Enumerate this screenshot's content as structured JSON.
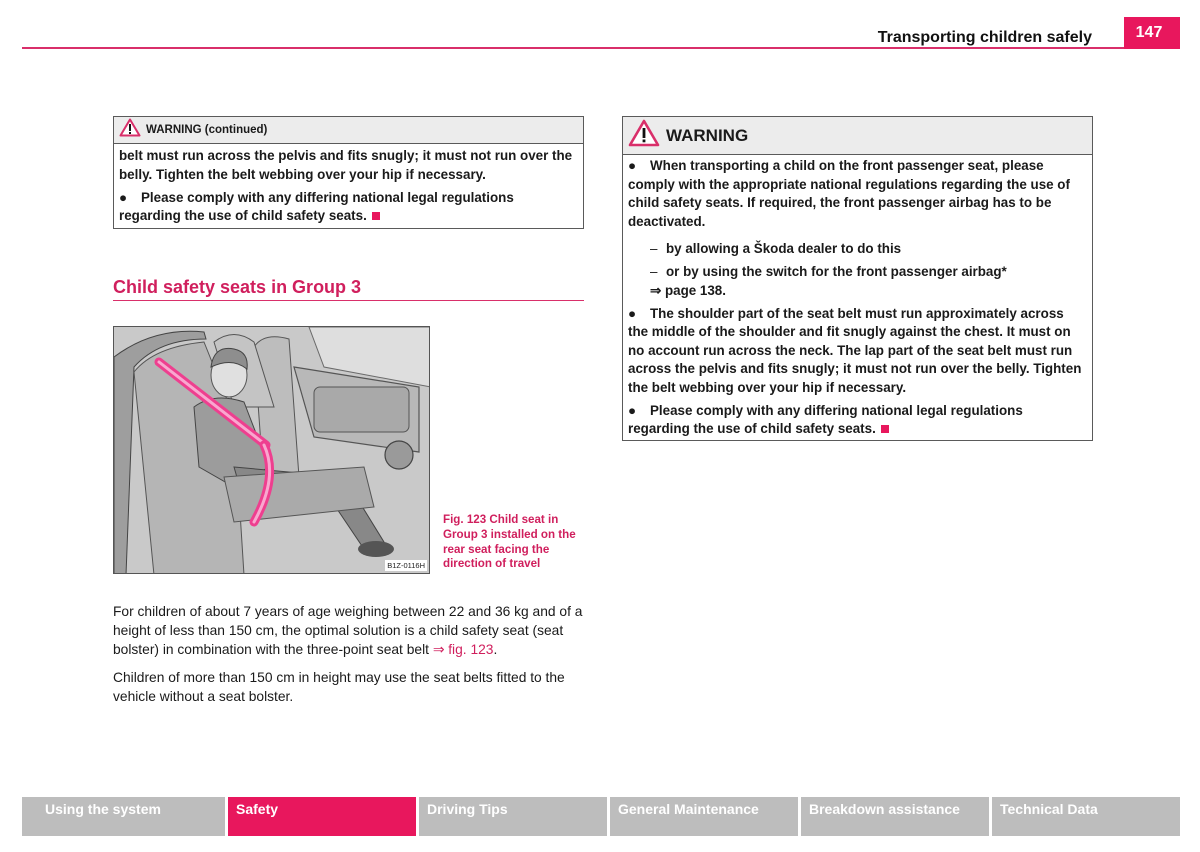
{
  "header": {
    "title": "Transporting children safely",
    "page_number": "147"
  },
  "warning_continued": {
    "title": "WARNING (continued)",
    "paragraphs": [
      "belt must run across the pelvis and fits snugly; it must not run over the belly. Tighten the belt webbing over your hip if necessary.",
      "Please comply with any differing national legal regulations regarding the use of child safety seats."
    ]
  },
  "section": {
    "title": "Child safety seats in Group 3"
  },
  "figure": {
    "code": "B1Z-0116H",
    "caption": "Fig. 123   Child seat in Group 3 installed on the rear seat facing the direction of travel"
  },
  "body": {
    "para1_text": "For children of about 7 years of age weighing between 22 and 36 kg and of a height of less than 150 cm, the optimal solution is a child safety seat (seat bolster) in combination with the three-point seat belt ",
    "para1_link": "⇒ fig. 123",
    "para1_end": ".",
    "para2": "Children of more than 150 cm in height may use the seat belts fitted to the vehicle without a seat bolster."
  },
  "warning": {
    "title": "WARNING",
    "bullet1": "When transporting a child on the front passenger seat, please comply with the appropriate national regulations regarding the use of child safety seats.  If required, the front passenger airbag has to be deactivated.",
    "dash1": "by allowing a Škoda dealer to do this",
    "dash2": "or by using the switch for the front passenger airbag*",
    "dash2_ref": "⇒ page 138.",
    "bullet2": "The shoulder part of the seat belt must run approximately across the middle of the shoulder and fit snugly against the chest. It must on no account run across the neck. The lap part of the seat belt must run across the pelvis and fits snugly; it must not run over the belly. Tighten the belt webbing over your hip if necessary.",
    "bullet3": "Please comply with any differing national legal regulations regarding the use of child safety seats."
  },
  "nav": {
    "tabs": [
      {
        "label": "Using the system",
        "active": false
      },
      {
        "label": "Safety",
        "active": true
      },
      {
        "label": "Driving Tips",
        "active": false
      },
      {
        "label": "General Maintenance",
        "active": false
      },
      {
        "label": "Breakdown assistance",
        "active": false
      },
      {
        "label": "Technical Data",
        "active": false
      }
    ]
  },
  "colors": {
    "brand": "#e8175d",
    "heading": "#d01f5d",
    "nav_inactive": "#bdbdbd"
  }
}
